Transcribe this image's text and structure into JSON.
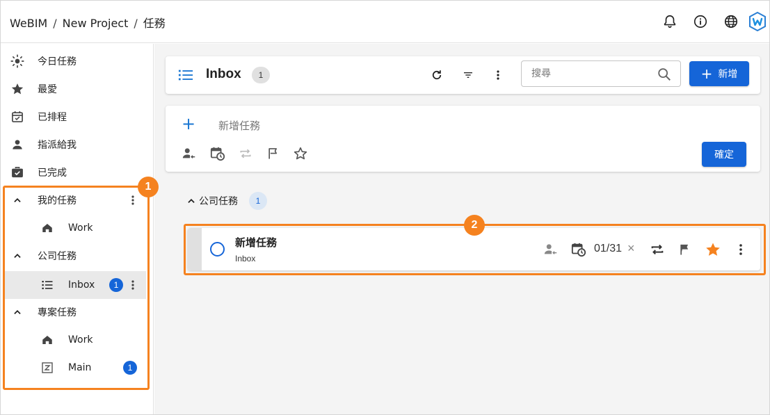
{
  "topbar": {
    "breadcrumb": [
      "WeBIM",
      "New Project",
      "任務"
    ],
    "separator": "/",
    "icons": [
      "bell-icon",
      "info-icon",
      "globe-icon",
      "app-logo"
    ]
  },
  "sidebar": {
    "nav": [
      {
        "label": "今日任務",
        "icon": "sun-icon"
      },
      {
        "label": "最愛",
        "icon": "star-icon"
      },
      {
        "label": "已排程",
        "icon": "calendar-check-icon"
      },
      {
        "label": "指派給我",
        "icon": "person-icon"
      },
      {
        "label": "已完成",
        "icon": "briefcase-check-icon"
      }
    ],
    "groups": [
      {
        "label": "我的任務",
        "children": [
          {
            "label": "Work",
            "icon": "home-icon"
          }
        ]
      },
      {
        "label": "公司任務",
        "children": [
          {
            "label": "Inbox",
            "icon": "list-icon",
            "count": "1",
            "active": true
          }
        ]
      },
      {
        "label": "專案任務",
        "children": [
          {
            "label": "Work",
            "icon": "home-icon"
          },
          {
            "label": "Main",
            "icon": "z-box-icon",
            "count": "1"
          }
        ]
      }
    ]
  },
  "header": {
    "title": "Inbox",
    "count": "1",
    "search_placeholder": "搜尋",
    "add_label": "新增",
    "add_plus": "+"
  },
  "newtask": {
    "plus": "+",
    "placeholder": "新增任務",
    "confirm_label": "確定"
  },
  "group": {
    "label": "公司任務",
    "count": "1"
  },
  "task": {
    "title": "新增任務",
    "list": "Inbox",
    "date": "01/31",
    "clear": "×",
    "starred": true
  },
  "callouts": [
    "1",
    "2"
  ],
  "colors": {
    "accent": "#1565d8",
    "callout": "#f5821f",
    "star": "#f5821f"
  }
}
